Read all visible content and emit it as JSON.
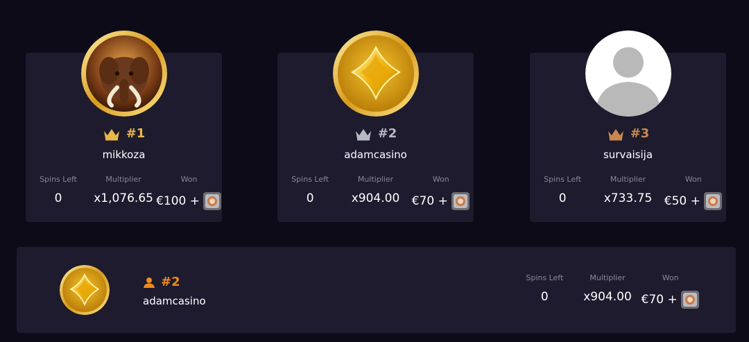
{
  "leaderboard": [
    {
      "rank": "#1",
      "tier": "gold",
      "username": "mikkoza",
      "avatar": "mammoth-avatar",
      "spins_left": "0",
      "multiplier": "x1,076.65",
      "won": "€100 +",
      "prize_icon": "prize-chip-icon"
    },
    {
      "rank": "#2",
      "tier": "silver",
      "username": "adamcasino",
      "avatar": "diamond-avatar",
      "spins_left": "0",
      "multiplier": "x904.00",
      "won": "€70 +",
      "prize_icon": "prize-chip-icon"
    },
    {
      "rank": "#3",
      "tier": "bronze",
      "username": "survaisija",
      "avatar": "default-user-avatar",
      "spins_left": "0",
      "multiplier": "x733.75",
      "won": "€50 +",
      "prize_icon": "prize-chip-icon"
    }
  ],
  "labels": {
    "spins_left": "Spins Left",
    "multiplier": "Multiplier",
    "won": "Won"
  },
  "current_user": {
    "rank": "#2",
    "username": "adamcasino",
    "avatar": "diamond-avatar",
    "spins_left": "0",
    "multiplier": "x904.00",
    "won": "€70 +"
  },
  "colors": {
    "background": "#0d0b17",
    "card": "#1d1b2d",
    "gold": "#e8b64a",
    "silver": "#b8b8c4",
    "bronze": "#c98850",
    "accent_orange": "#f08a1d",
    "muted_label": "#8a8799"
  }
}
